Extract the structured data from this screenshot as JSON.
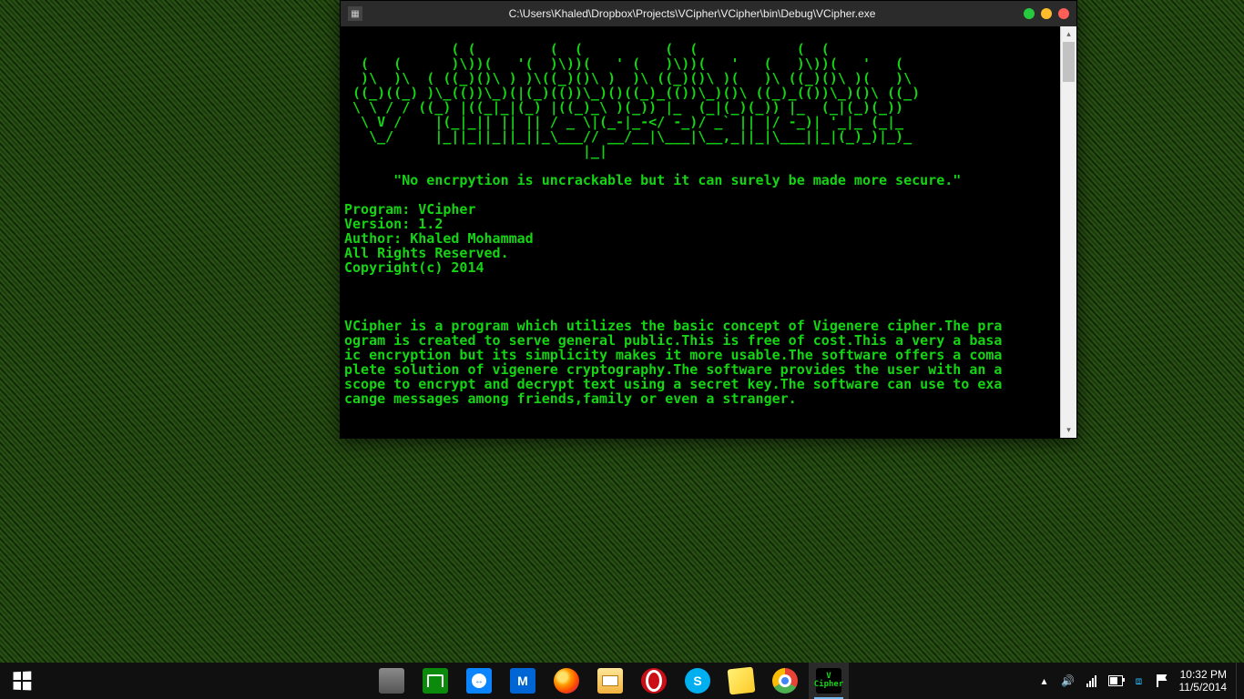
{
  "window": {
    "title_path": "C:\\Users\\Khaled\\Dropbox\\Projects\\VCipher\\VCipher\\bin\\Debug\\VCipher.exe",
    "ascii_art": "             ( (         (  (          (  (            (  (           \n  (   (      )\\))(   '(  )\\))(   ' (   )\\))(   '   (   )\\))(   '   (  \n  )\\  )\\  ( ((_)()\\ ) )\\((_)()\\ )  )\\ ((_)()\\ )(   )\\ ((_)()\\ )(   )\\ \n ((_)((_) )\\_(())\\_)(|(_)(())\\_)()((_)_(())\\_)()\\ ((_)_(())\\_)()\\ ((_)\n \\ \\ / / ((_) |((_|_|(_) |((_)_\\ )(_)) |_  (_|(_)(_)) |_  (_|(_)(_))  \n  \\ V /    |(_|_|| || || / _ \\|(_-|_-</ -_)/ _` || |/ -_)| '_|_ (_|_  \n   \\_/     |_||_||_||_||_\\___// __/__|\\___|\\__,_||_|\\___||_|(_)_)|_)_ \n                             |_|                                       ",
    "quote": "\"No encrpytion is uncrackable but it can surely be made more secure.\"",
    "meta": {
      "program_label": "Program:",
      "program_value": "VCipher",
      "version_label": "Version:",
      "version_value": "1.2",
      "author_label": "Author:",
      "author_value": "Khaled Mohammad",
      "rights": "All Rights Reserved.",
      "copyright": "Copyright(c) 2014"
    },
    "body_lines": [
      "VCipher is a program which utilizes the basic concept of Vigenere cipher.The pra",
      "ogram is created to serve general public.This is free of cost.This a very a basa",
      "ic encryption but its simplicity makes it more usable.The software offers a coma",
      "plete solution of vigenere cryptography.The software provides the user with an a",
      "scope to encrypt and decrypt text using a secret key.The software can use to exa",
      "cange messages among friends,family or even a stranger."
    ],
    "scroll_up_glyph": "▴",
    "scroll_down_glyph": "▾",
    "controls": {
      "min_name": "minimize",
      "max_name": "maximize",
      "close_name": "close"
    }
  },
  "taskbar": {
    "apps": [
      {
        "name": "server-app",
        "label": ""
      },
      {
        "name": "store-app",
        "label": ""
      },
      {
        "name": "teamviewer-app",
        "label": "↔"
      },
      {
        "name": "malwarebytes-app",
        "label": "M"
      },
      {
        "name": "firefox-app",
        "label": ""
      },
      {
        "name": "file-explorer-app",
        "label": ""
      },
      {
        "name": "opera-app",
        "label": ""
      },
      {
        "name": "skype-app",
        "label": "S"
      },
      {
        "name": "sticky-notes-app",
        "label": ""
      },
      {
        "name": "chrome-app",
        "label": ""
      },
      {
        "name": "vcipher-app",
        "label": "V\nCipher"
      }
    ],
    "active_app": "vcipher-app",
    "tray": {
      "chevron_glyph": "▴",
      "speaker_glyph": "🔊",
      "dropbox_glyph": "⧈"
    },
    "clock": {
      "time": "10:32 PM",
      "date": "11/5/2014"
    }
  }
}
